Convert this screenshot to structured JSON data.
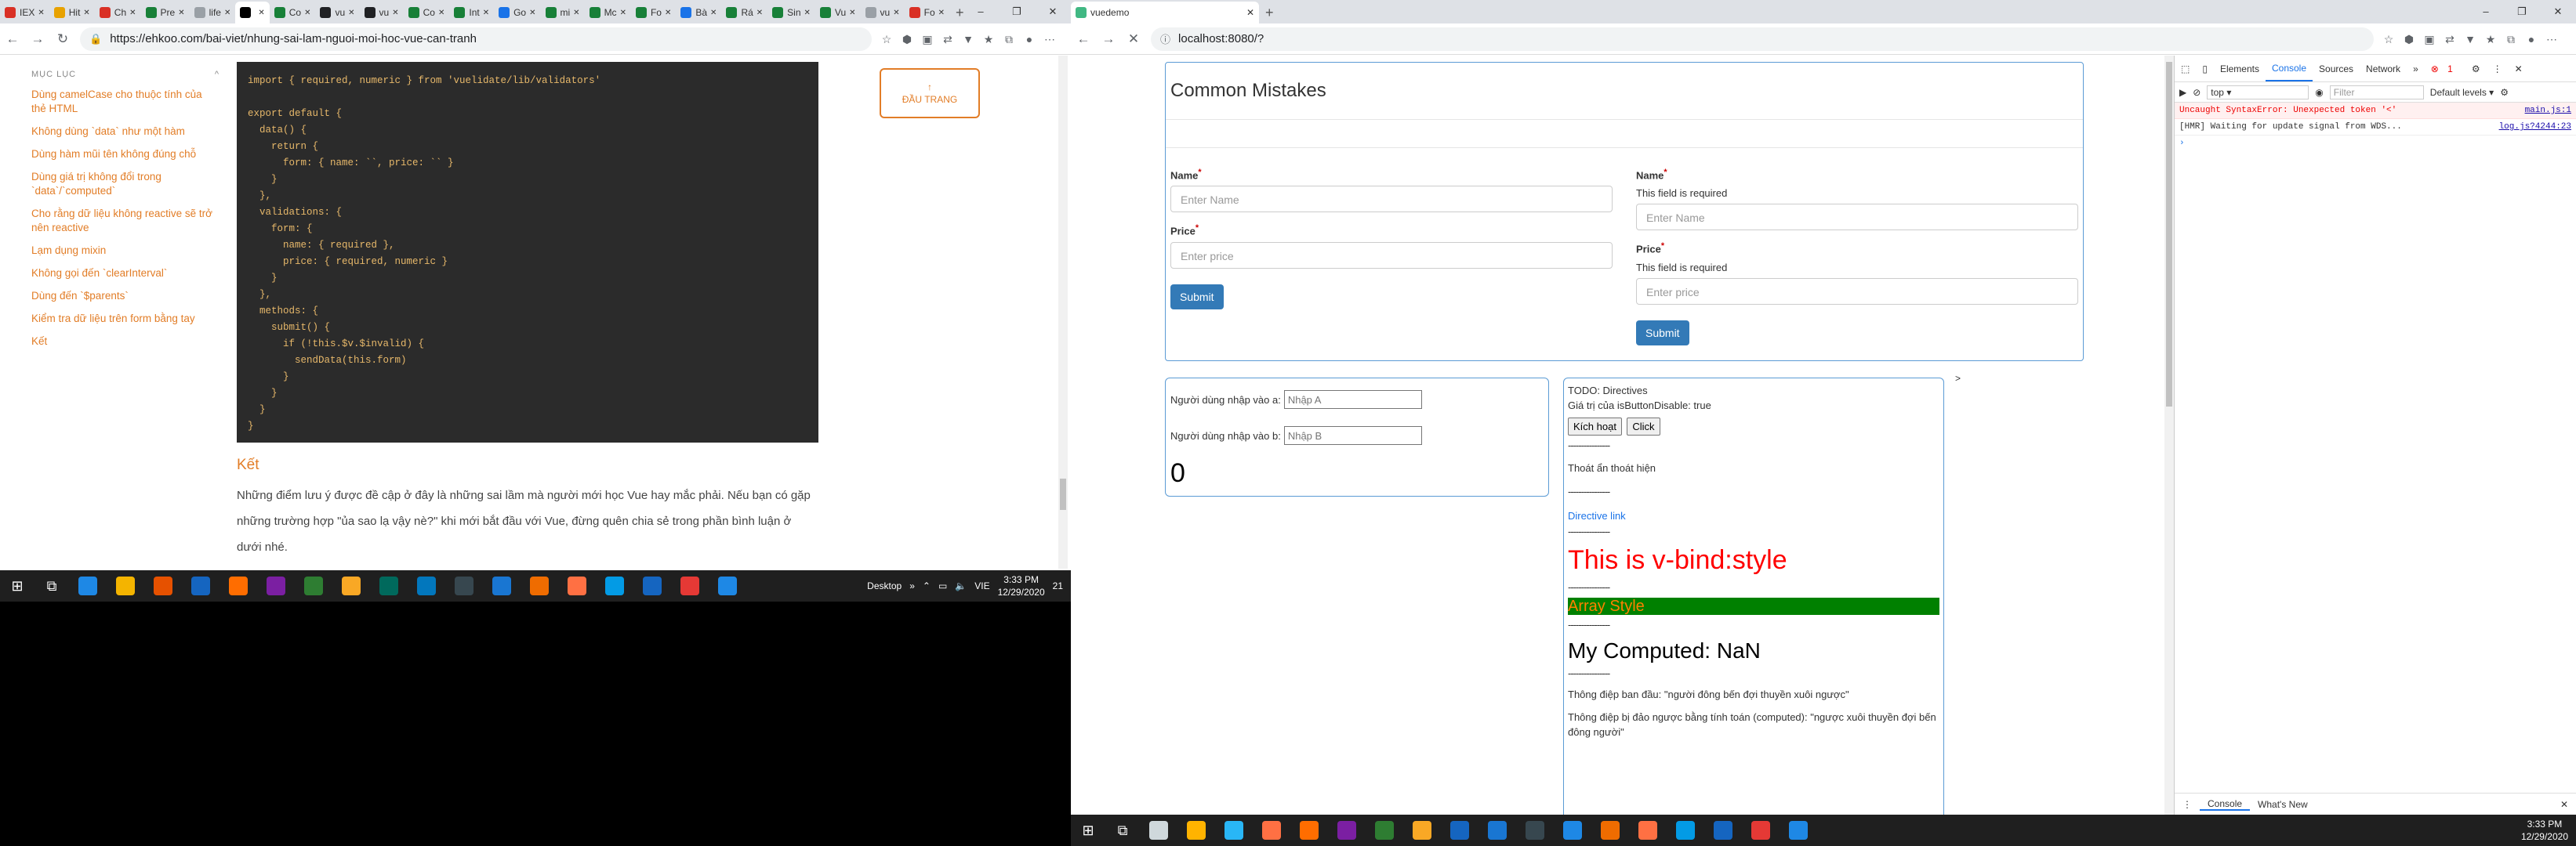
{
  "left_browser": {
    "tabs": [
      {
        "label": "IEX",
        "color": "#d93025"
      },
      {
        "label": "Hit",
        "color": "#e8a200"
      },
      {
        "label": "Ch",
        "color": "#d93025"
      },
      {
        "label": "Pre",
        "color": "#188038"
      },
      {
        "label": "life",
        "color": "#9aa0a6"
      },
      {
        "label": "",
        "color": "#000000",
        "active": true
      },
      {
        "label": "Co",
        "color": "#188038"
      },
      {
        "label": "vu",
        "color": "#202124"
      },
      {
        "label": "vu",
        "color": "#202124"
      },
      {
        "label": "Co",
        "color": "#188038"
      },
      {
        "label": "Int",
        "color": "#188038"
      },
      {
        "label": "Go",
        "color": "#1a73e8"
      },
      {
        "label": "mi",
        "color": "#188038"
      },
      {
        "label": "Mc",
        "color": "#188038"
      },
      {
        "label": "Fo",
        "color": "#188038"
      },
      {
        "label": "Bà",
        "color": "#1a73e8"
      },
      {
        "label": "Rá",
        "color": "#188038"
      },
      {
        "label": "Sin",
        "color": "#188038"
      },
      {
        "label": "Vu",
        "color": "#188038"
      },
      {
        "label": "vu",
        "color": "#9aa0a6"
      },
      {
        "label": "Fo",
        "color": "#d93025"
      }
    ],
    "url": "https://ehkoo.com/bai-viet/nhung-sai-lam-nguoi-moi-hoc-vue-can-tranh"
  },
  "article": {
    "toc_heading": "MỤC LỤC",
    "toc_collapse": "^",
    "toc": [
      "Dùng camelCase cho thuộc tính của thẻ HTML",
      "Không dùng `data` như một hàm",
      "Dùng hàm mũi tên không đúng chỗ",
      "Dùng giá trị không đổi trong `data`/`computed`",
      "Cho rằng dữ liệu không reactive sẽ trở nên reactive",
      "Lạm dụng mixin",
      "Không gọi đến `clearInterval`",
      "Dùng đến `$parents`",
      "Kiểm tra dữ liệu trên form bằng tay",
      "Kết"
    ],
    "code_lines": [
      "import { required, numeric } from 'vuelidate/lib/validators'",
      "",
      "export default {",
      "  data() {",
      "    return {",
      "      form: { name: ``, price: `` }",
      "    }",
      "  },",
      "  validations: {",
      "    form: {",
      "      name: { required },",
      "      price: { required, numeric }",
      "    }",
      "  },",
      "  methods: {",
      "    submit() {",
      "      if (!this.$v.$invalid) {",
      "        sendData(this.form)",
      "      }",
      "    }",
      "  }",
      "}"
    ],
    "ket_heading": "Kết",
    "paragraph": "Những điểm lưu ý được đề cập ở đây là những sai lầm mà người mới học Vue hay mắc phải. Nếu bạn có gặp những trường hợp \"ủa sao lạ vậy nè?\" khi mới bắt đầu với Vue, đừng quên chia sẻ trong phần bình luận ở dưới nhé.",
    "back_to_top_arrow": "↑",
    "back_to_top": "ĐẦU TRANG"
  },
  "taskbar_left": {
    "desktop_label": "Desktop",
    "chevron": "»",
    "lang": "VIE",
    "time": "3:33 PM",
    "date": "12/29/2020",
    "notif": "21",
    "apps": [
      "#1e88e5",
      "#f4b400",
      "#e65100",
      "#1565c0",
      "#ff6d00",
      "#7b1fa2",
      "#2e7d32",
      "#f9a825",
      "#00695c",
      "#0277bd",
      "#37474f",
      "#1976d2",
      "#ef6c00",
      "#ff7043",
      "#039be5",
      "#1565c0",
      "#e53935",
      "#1e88e5"
    ]
  },
  "right_browser": {
    "tab_title": "vuedemo",
    "url": "localhost:8080/?"
  },
  "form_demo": {
    "title": "Common Mistakes",
    "name_label": "Name",
    "price_label": "Price",
    "required_mark": "*",
    "name_placeholder": "Enter Name",
    "price_placeholder": "Enter price",
    "error_text": "This field is required",
    "submit_label": "Submit"
  },
  "calc": {
    "label_a": "Người dùng nhập vào a:",
    "placeholder_a": "Nhập A",
    "label_b": "Người dùng nhập vào b:",
    "placeholder_b": "Nhập B",
    "sum": "0"
  },
  "directives": {
    "arrow": ">",
    "todo": "TODO: Directives",
    "button_disable": "Giá trị của isButtonDisable: true",
    "activate_label": "Kích hoạt",
    "click_label": "Click",
    "dash": "----------------",
    "show_hide": "Thoát ẩn thoát hiện",
    "directive_link": "Directive link",
    "bind_style": "This is v-bind:style",
    "array_style": "Array Style",
    "computed": "My Computed: NaN",
    "original_msg": "Thông điệp ban đầu: \"người đông bến đợi thuyền xuôi ngược\"",
    "reversed_msg": "Thông điệp bị đảo ngược bằng tính toán (computed): \"ngược xuôi thuyền đợi bến đông người\""
  },
  "devtools": {
    "tabs": [
      "Elements",
      "Console",
      "Sources",
      "Network",
      "»"
    ],
    "error_badge": "1",
    "context": "top",
    "filter_placeholder": "Filter",
    "levels": "Default levels ▾",
    "messages": [
      {
        "type": "err",
        "text": "Uncaught SyntaxError: Unexpected token '<'",
        "source": "main.js:1"
      },
      {
        "type": "log",
        "text": "[HMR] Waiting for update signal from WDS...",
        "source": "log.js?4244:23"
      }
    ],
    "prompt": "›",
    "bottom_tabs": [
      "Console",
      "What's New"
    ]
  },
  "taskbar_right": {
    "time": "3:33 PM",
    "date": "12/29/2020",
    "apps": [
      "#cfd8dc",
      "#ffb300",
      "#29b6f6",
      "#ff7043",
      "#ff6d00",
      "#7b1fa2",
      "#2e7d32",
      "#f9a825",
      "#1565c0",
      "#1976d2",
      "#37474f",
      "#1e88e5",
      "#ef6c00",
      "#ff7043",
      "#039be5",
      "#1565c0",
      "#e53935",
      "#1e88e5"
    ]
  }
}
